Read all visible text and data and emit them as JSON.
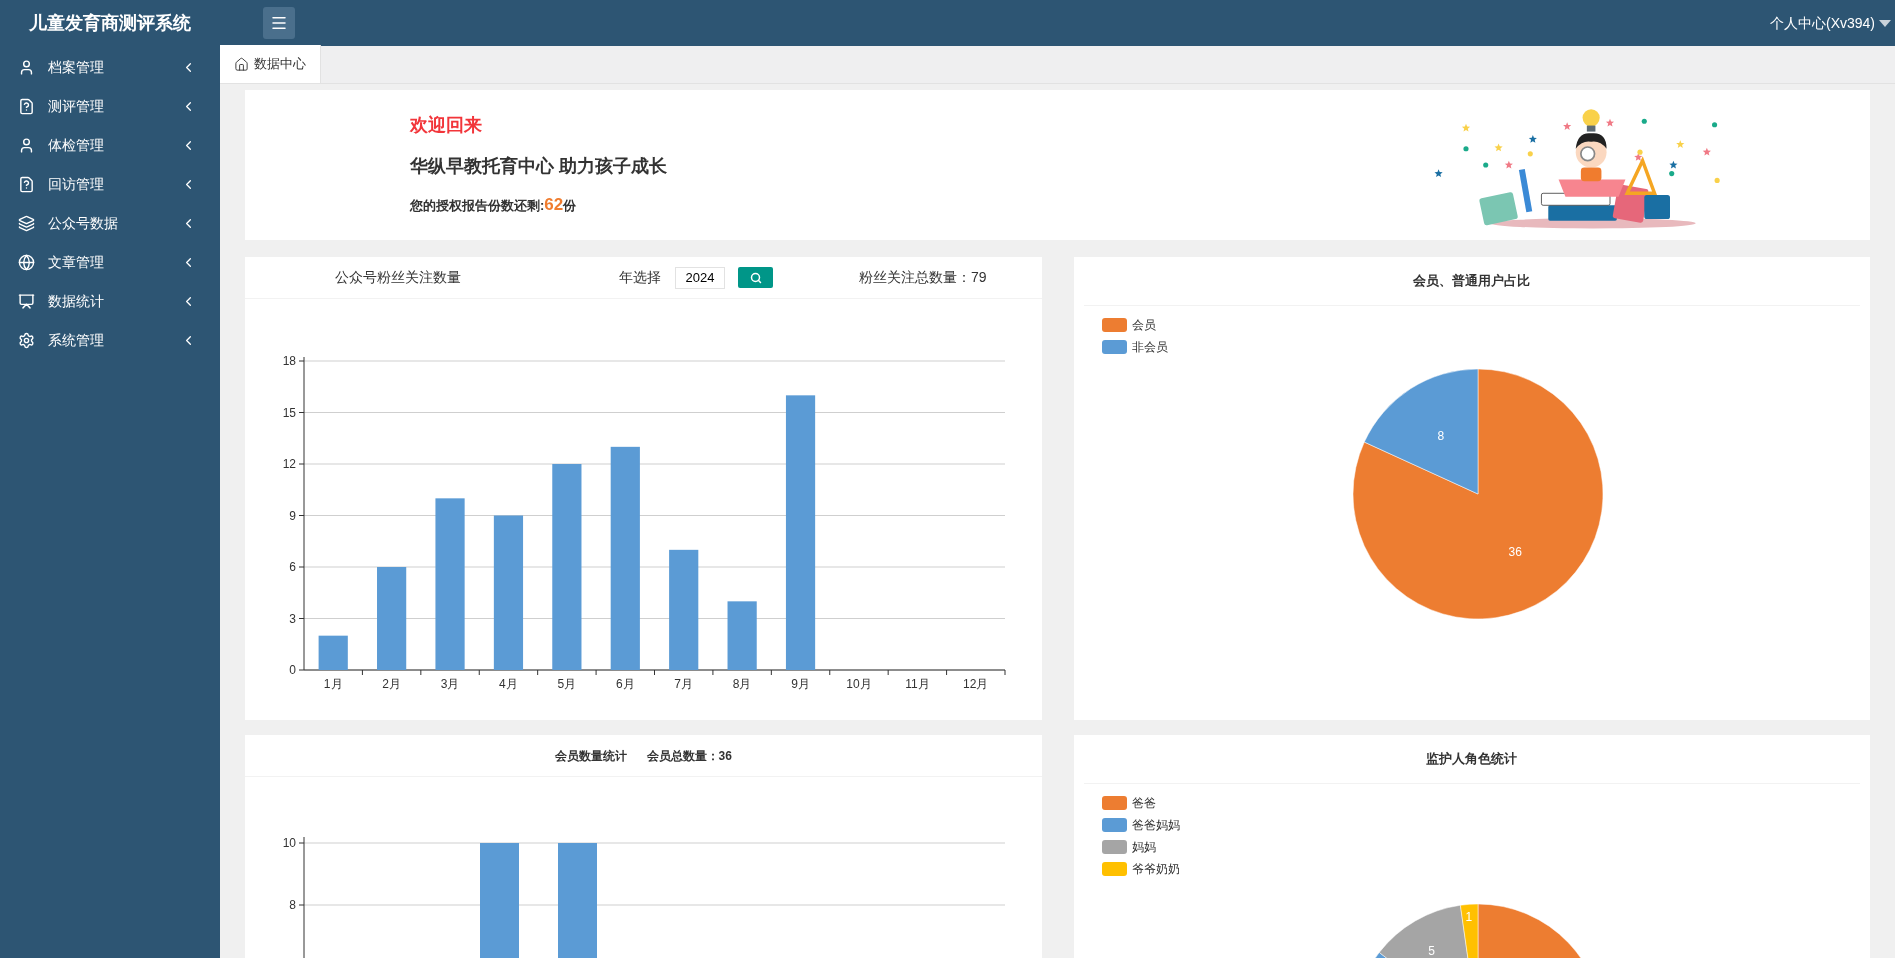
{
  "header": {
    "title": "儿童发育商测评系统",
    "user_menu": "个人中心(Xv394)"
  },
  "sidebar": {
    "items": [
      {
        "label": "档案管理",
        "expanded": false
      },
      {
        "label": "测评管理",
        "expanded": false
      },
      {
        "label": "体检管理",
        "expanded": false
      },
      {
        "label": "回访管理",
        "expanded": false
      },
      {
        "label": "公众号数据",
        "expanded": false
      },
      {
        "label": "文章管理",
        "expanded": false
      },
      {
        "label": "数据统计",
        "expanded": false
      },
      {
        "label": "系统管理",
        "expanded": false
      }
    ]
  },
  "tabs": [
    {
      "label": "数据中心",
      "selected": true
    }
  ],
  "welcome": {
    "greeting": "欢迎回来",
    "slogan": "华纵早教托育中心 助力孩子成长",
    "quota_label": "您的授权报告份数还剩:",
    "quota_value": "62",
    "quota_unit": "份"
  },
  "fans_chart": {
    "title": "公众号粉丝关注数量",
    "year_label": "年选择",
    "year_value": "2024",
    "total": "粉丝关注总数量：79",
    "chart_data": {
      "type": "bar",
      "categories": [
        "1月",
        "2月",
        "3月",
        "4月",
        "5月",
        "6月",
        "7月",
        "8月",
        "9月",
        "10月",
        "11月",
        "12月"
      ],
      "series": [
        {
          "color": "#5b9bd5",
          "values": [
            2,
            6,
            10,
            9,
            12,
            13,
            7,
            4,
            16,
            0,
            0,
            0
          ]
        }
      ],
      "ylim": [
        0,
        18
      ],
      "yticks": [
        0,
        3,
        6,
        9,
        12,
        15,
        18
      ],
      "grid": true
    }
  },
  "member_pie": {
    "title": "会员、普通用户占比",
    "chart_data": {
      "type": "pie",
      "categories": [
        "会员",
        "非会员"
      ],
      "series": [
        {
          "values": [
            36,
            8
          ]
        }
      ],
      "colors": [
        "#ed7d31",
        "#5b9bd5"
      ],
      "data_labels": true
    }
  },
  "member_bar": {
    "title": "会员数量统计",
    "total": "会员总数量：36",
    "y_tick_labels": [
      "10",
      "8"
    ]
  },
  "guardian_pie": {
    "title": "监护人角色统计",
    "items": [
      {
        "label": "爸爸",
        "color": "#ed7d31"
      },
      {
        "label": "爸爸妈妈",
        "color": "#5b9bd5"
      },
      {
        "label": "妈妈",
        "color": "#a5a5a5",
        "value_label": "5"
      },
      {
        "label": "爷爷奶奶",
        "color": "#ffc000",
        "value_label": "1"
      }
    ]
  }
}
